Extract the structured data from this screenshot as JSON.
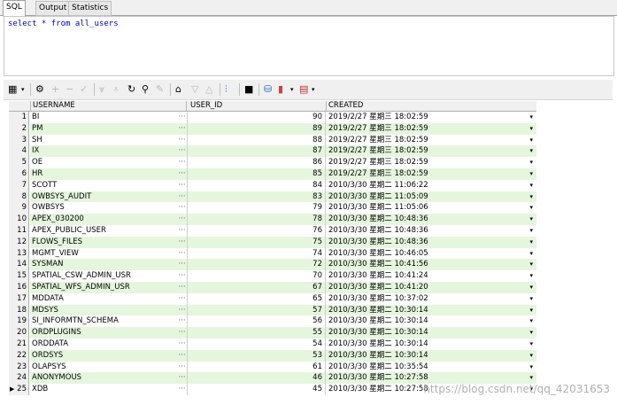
{
  "tabs": [
    {
      "label": "SQL",
      "active": true
    },
    {
      "label": "Output",
      "active": false
    },
    {
      "label": "Statistics",
      "active": false
    }
  ],
  "editor": {
    "sql": "select * from all_users"
  },
  "toolbar": {
    "icons": [
      "grid-icon",
      "dropdown-arrow",
      "query-icon",
      "add-row-icon",
      "delete-row-icon",
      "post-icon",
      "filter-down-icon",
      "filter-icon",
      "refresh-icon",
      "find-icon",
      "clear-icon",
      "lock-icon",
      "prev-icon",
      "next-icon",
      "chart-icon",
      "save-icon",
      "print-icon",
      "export-icon",
      "dropdown-arrow",
      "table-icon",
      "dropdown-arrow"
    ]
  },
  "grid": {
    "columns": [
      "USERNAME",
      "USER_ID",
      "CREATED"
    ],
    "rows": [
      {
        "n": "1",
        "username": "BI",
        "id": "90",
        "created": "2019/2/27 星期三 18:02:59"
      },
      {
        "n": "2",
        "username": "PM",
        "id": "89",
        "created": "2019/2/27 星期三 18:02:59"
      },
      {
        "n": "3",
        "username": "SH",
        "id": "88",
        "created": "2019/2/27 星期三 18:02:59"
      },
      {
        "n": "4",
        "username": "IX",
        "id": "87",
        "created": "2019/2/27 星期三 18:02:59"
      },
      {
        "n": "5",
        "username": "OE",
        "id": "86",
        "created": "2019/2/27 星期三 18:02:59"
      },
      {
        "n": "6",
        "username": "HR",
        "id": "85",
        "created": "2019/2/27 星期三 18:02:59"
      },
      {
        "n": "7",
        "username": "SCOTT",
        "id": "84",
        "created": "2010/3/30 星期二 11:06:22"
      },
      {
        "n": "8",
        "username": "OWBSYS_AUDIT",
        "id": "83",
        "created": "2010/3/30 星期二 11:05:09"
      },
      {
        "n": "9",
        "username": "OWBSYS",
        "id": "79",
        "created": "2010/3/30 星期二 11:05:06"
      },
      {
        "n": "10",
        "username": "APEX_030200",
        "id": "78",
        "created": "2010/3/30 星期二 10:48:36"
      },
      {
        "n": "11",
        "username": "APEX_PUBLIC_USER",
        "id": "76",
        "created": "2010/3/30 星期二 10:48:36"
      },
      {
        "n": "12",
        "username": "FLOWS_FILES",
        "id": "75",
        "created": "2010/3/30 星期二 10:48:36"
      },
      {
        "n": "13",
        "username": "MGMT_VIEW",
        "id": "74",
        "created": "2010/3/30 星期二 10:46:05"
      },
      {
        "n": "14",
        "username": "SYSMAN",
        "id": "72",
        "created": "2010/3/30 星期二 10:41:56"
      },
      {
        "n": "15",
        "username": "SPATIAL_CSW_ADMIN_USR",
        "id": "70",
        "created": "2010/3/30 星期二 10:41:24"
      },
      {
        "n": "16",
        "username": "SPATIAL_WFS_ADMIN_USR",
        "id": "67",
        "created": "2010/3/30 星期二 10:41:20"
      },
      {
        "n": "17",
        "username": "MDDATA",
        "id": "65",
        "created": "2010/3/30 星期二 10:37:02"
      },
      {
        "n": "18",
        "username": "MDSYS",
        "id": "57",
        "created": "2010/3/30 星期二 10:30:14"
      },
      {
        "n": "19",
        "username": "SI_INFORMTN_SCHEMA",
        "id": "56",
        "created": "2010/3/30 星期二 10:30:14"
      },
      {
        "n": "20",
        "username": "ORDPLUGINS",
        "id": "55",
        "created": "2010/3/30 星期二 10:30:14"
      },
      {
        "n": "21",
        "username": "ORDDATA",
        "id": "54",
        "created": "2010/3/30 星期二 10:30:14"
      },
      {
        "n": "22",
        "username": "ORDSYS",
        "id": "53",
        "created": "2010/3/30 星期二 10:30:14"
      },
      {
        "n": "23",
        "username": "OLAPSYS",
        "id": "61",
        "created": "2010/3/30 星期二 10:35:54"
      },
      {
        "n": "24",
        "username": "ANONYMOUS",
        "id": "46",
        "created": "2010/3/30 星期二 10:27:58"
      },
      {
        "n": "25",
        "username": "XDB",
        "id": "45",
        "created": "2010/3/30 星期二 10:27:58"
      }
    ],
    "cell_dots": "···",
    "dropdown_glyph": "▾",
    "current_row_marker": "▶"
  },
  "watermark": "https://blog.csdn.net/qq_42031653",
  "colors": {
    "alt_row": "#e4f7dc",
    "sql_keyword": "#0000c0"
  }
}
